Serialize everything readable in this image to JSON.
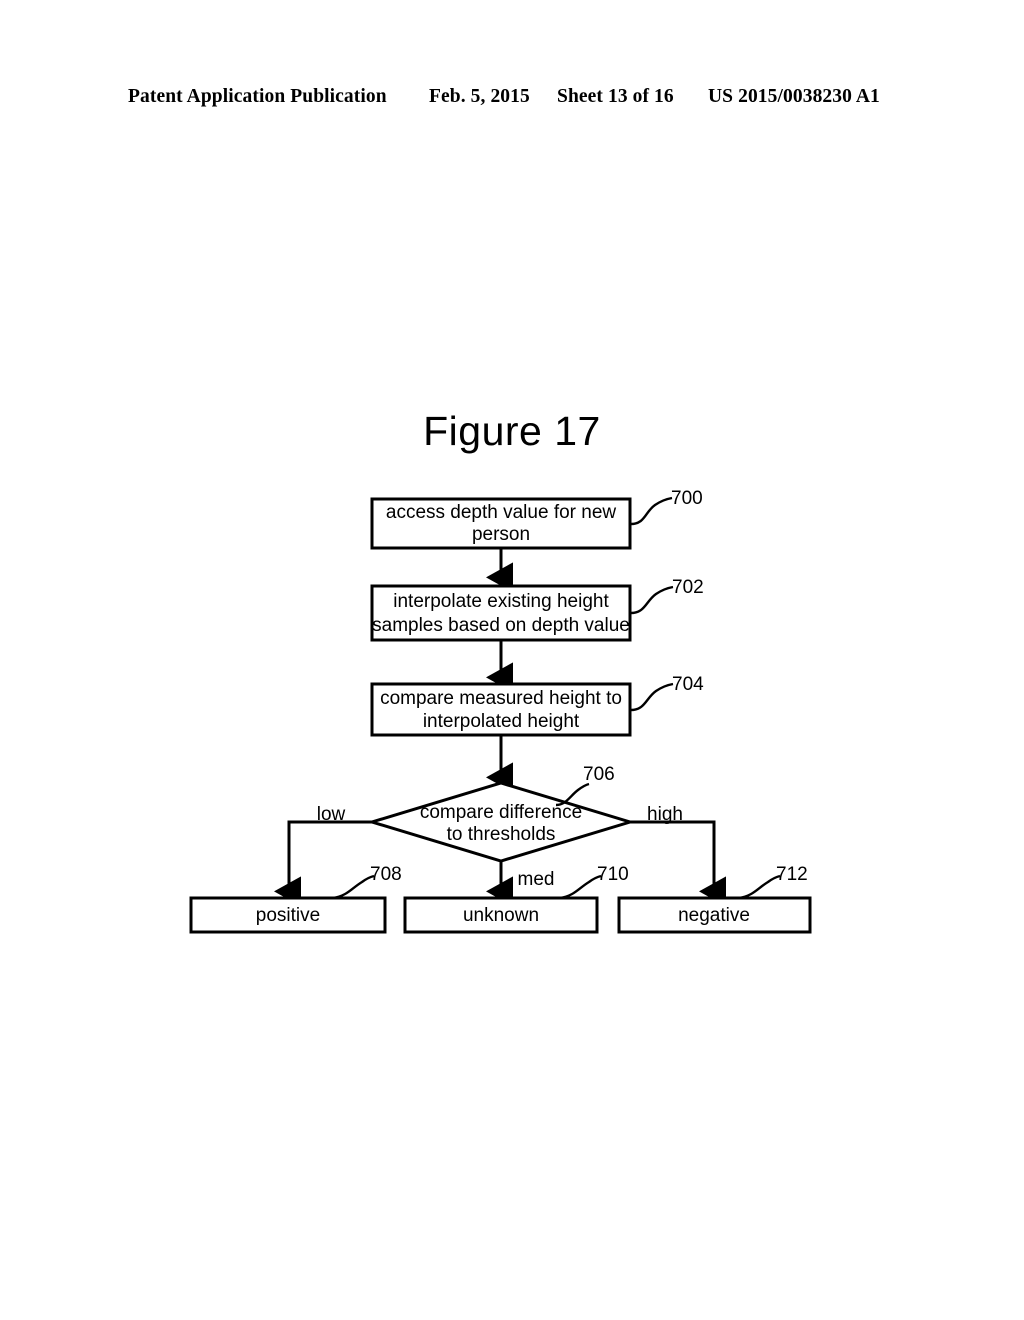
{
  "header": {
    "publication": "Patent Application Publication",
    "date": "Feb. 5, 2015",
    "sheet": "Sheet 13 of 16",
    "patent_number": "US 2015/0038230 A1"
  },
  "figure": {
    "title": "Figure 17"
  },
  "flowchart": {
    "nodes": [
      {
        "id": "700",
        "ref": "700",
        "shape": "rectangle",
        "lines": [
          "access depth value for new",
          "person"
        ]
      },
      {
        "id": "702",
        "ref": "702",
        "shape": "rectangle",
        "lines": [
          "interpolate existing height",
          "samples based on depth value"
        ]
      },
      {
        "id": "704",
        "ref": "704",
        "shape": "rectangle",
        "lines": [
          "compare measured height to",
          "interpolated height"
        ]
      },
      {
        "id": "706",
        "ref": "706",
        "shape": "diamond",
        "lines": [
          "compare difference",
          "to thresholds"
        ]
      },
      {
        "id": "708",
        "ref": "708",
        "shape": "rectangle",
        "lines": [
          "positive"
        ]
      },
      {
        "id": "710",
        "ref": "710",
        "shape": "rectangle",
        "lines": [
          "unknown"
        ]
      },
      {
        "id": "712",
        "ref": "712",
        "shape": "rectangle",
        "lines": [
          "negative"
        ]
      }
    ],
    "edge_labels": {
      "low": "low",
      "med": "med",
      "high": "high"
    }
  },
  "colors": {
    "ink": "#000000",
    "paper": "#ffffff"
  }
}
